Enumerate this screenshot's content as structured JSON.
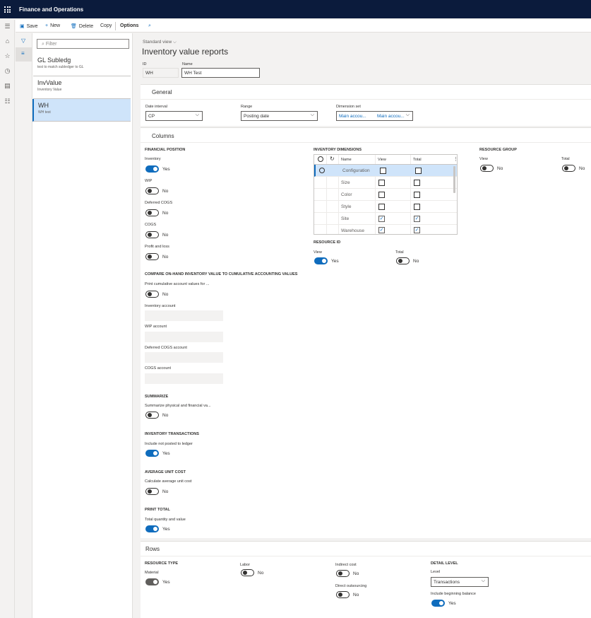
{
  "app": {
    "title": "Finance and Operations"
  },
  "commands": {
    "save": "Save",
    "new": "New",
    "delete": "Delete",
    "copy": "Copy",
    "options": "Options"
  },
  "list": {
    "filter_placeholder": "Filter",
    "items": [
      {
        "name": "GL Subledg",
        "desc": "test to match subledger to GL"
      },
      {
        "name": "InvValue",
        "desc": "Inventory Value"
      },
      {
        "name": "WH",
        "desc": "WH test"
      }
    ]
  },
  "page": {
    "view": "Standard view",
    "title": "Inventory value reports",
    "id_label": "ID",
    "id_value": "WH",
    "name_label": "Name",
    "name_value": "WH Test"
  },
  "general": {
    "title": "General",
    "date_interval_label": "Date interval",
    "date_interval_value": "CP",
    "range_label": "Range",
    "range_value": "Posting date",
    "dimset_label": "Dimension set",
    "dimset_value1": "Main accou...",
    "dimset_value2": "Main accou..."
  },
  "columns": {
    "title": "Columns",
    "fin_pos_header": "FINANCIAL POSITION",
    "inventory_label": "Inventory",
    "inventory_state": "Yes",
    "wip_label": "WIP",
    "wip_state": "No",
    "deferred_label": "Deferred COGS",
    "deferred_state": "No",
    "cogs_label": "COGS",
    "cogs_state": "No",
    "pl_label": "Profit and loss",
    "pl_state": "No",
    "compare_header": "COMPARE ON-HAND INVENTORY VALUE TO CUMULATIVE ACCOUNTING VALUES",
    "print_cum_label": "Print cumulative account values for ...",
    "print_cum_state": "No",
    "inv_account_label": "Inventory account",
    "wip_account_label": "WIP account",
    "deferred_account_label": "Deferred COGS account",
    "cogs_account_label": "COGS account",
    "summarize_header": "SUMMARIZE",
    "summarize_label": "Summarize physical and financial va...",
    "summarize_state": "No",
    "inv_trans_header": "INVENTORY TRANSACTIONS",
    "include_np_label": "Include not posted to ledger",
    "include_np_state": "Yes",
    "avg_header": "AVERAGE UNIT COST",
    "avg_label": "Calculate average unit cost",
    "avg_state": "No",
    "print_total_header": "PRINT TOTAL",
    "tqv_label": "Total quantity and value",
    "tqv_state": "Yes",
    "invdim_header": "INVENTORY DIMENSIONS",
    "grid_headers": {
      "name": "Name",
      "view": "View",
      "total": "Total"
    },
    "dimensions": [
      {
        "name": "Configuration",
        "view": false,
        "total": false
      },
      {
        "name": "Size",
        "view": false,
        "total": false
      },
      {
        "name": "Color",
        "view": false,
        "total": false
      },
      {
        "name": "Style",
        "view": false,
        "total": false
      },
      {
        "name": "Site",
        "view": true,
        "total": true
      },
      {
        "name": "Warehouse",
        "view": true,
        "total": true
      }
    ],
    "resid_header": "RESOURCE ID",
    "resid_view_label": "View",
    "resid_view_state": "Yes",
    "resid_total_label": "Total",
    "resid_total_state": "No",
    "resgroup_header": "RESOURCE GROUP",
    "resgroup_view_label": "View",
    "resgroup_view_state": "No",
    "resgroup_total_label": "Total",
    "resgroup_total_state": "No"
  },
  "rows": {
    "title": "Rows",
    "restype_header": "RESOURCE TYPE",
    "material_label": "Material",
    "material_state": "Yes",
    "labor_label": "Labor",
    "labor_state": "No",
    "indirect_label": "Indirect cost",
    "indirect_state": "No",
    "direct_label": "Direct outsourcing",
    "direct_state": "No",
    "detail_header": "DETAIL LEVEL",
    "level_label": "Level",
    "level_value": "Transactions",
    "begbal_label": "Include beginning balance",
    "begbal_state": "Yes"
  },
  "colors": {
    "accent": "#0f6cbd",
    "topbar": "#0b1b3c",
    "selected_row": "#cfe4fa"
  }
}
